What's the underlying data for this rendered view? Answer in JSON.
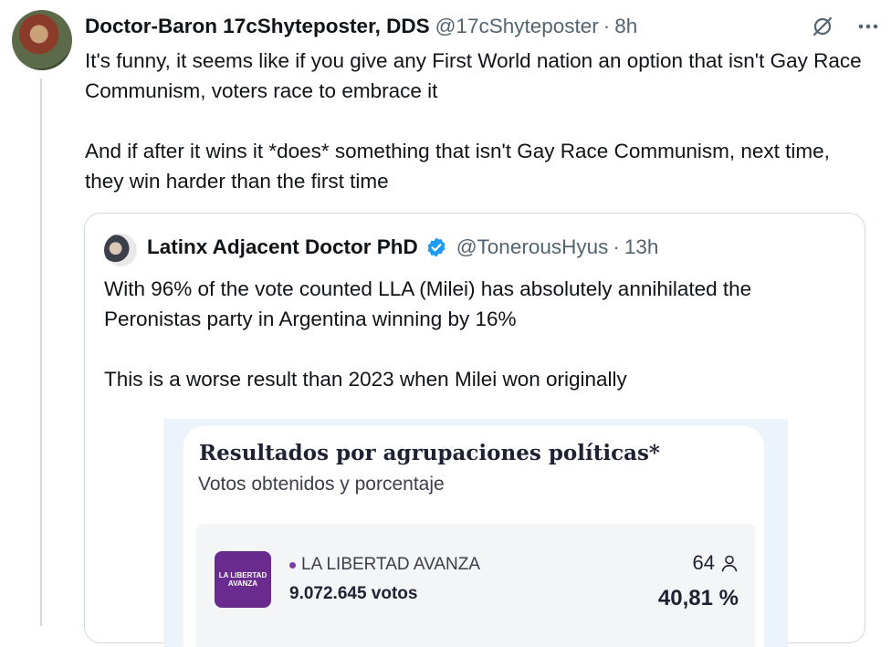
{
  "tweet": {
    "author_name": "Doctor-Baron 17cShyteposter, DDS",
    "handle": "@17cShyteposter",
    "separator": "·",
    "time": "8h",
    "paragraphs": [
      "It's funny, it seems like if you give any First World nation an option that isn't Gay Race Communism, voters race to embrace it",
      "And if after it wins it *does* something that isn't Gay Race Communism, next time, they win harder than the first time"
    ],
    "more_icon": "more-horizontal-icon",
    "grok_icon": "grok-slash-icon"
  },
  "quote": {
    "author_name": "Latinx Adjacent Doctor PhD",
    "handle": "@TonerousHyus",
    "separator": "·",
    "time": "13h",
    "verified_color": "#1d9bf0",
    "paragraphs": [
      "With 96% of the vote counted LLA (Milei) has absolutely annihilated the Peronistas party in Argentina winning by 16%",
      "This is a worse result than 2023 when Milei won originally"
    ]
  },
  "media": {
    "title": "Resultados por agrupaciones políticas*",
    "subtitle": "Votos obtenidos y porcentaje",
    "party": {
      "logo_text": "LA LIBERTAD AVANZA",
      "name": "LA LIBERTAD AVANZA",
      "votes": "9.072.645 votos",
      "seats": "64",
      "percent": "40,81 %",
      "color": "#6a2b8f"
    }
  }
}
